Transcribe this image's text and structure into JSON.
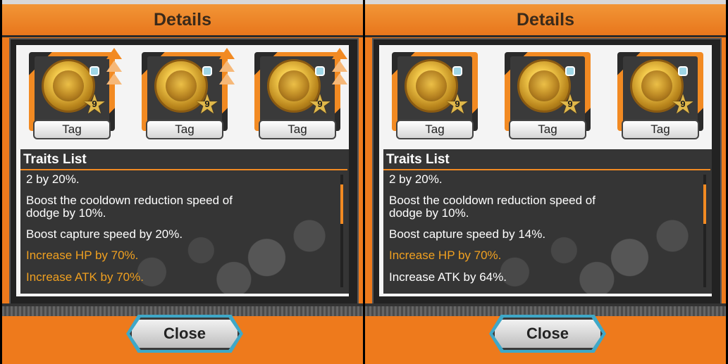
{
  "panels": [
    {
      "title": "Details",
      "cards": [
        {
          "tag": "Tag",
          "level": "9",
          "shield_icon": "shield-icon",
          "arrow_icon": "up-arrow-icon"
        },
        {
          "tag": "Tag",
          "level": "9",
          "shield_icon": "shield-icon",
          "arrow_icon": "up-arrow-icon"
        },
        {
          "tag": "Tag",
          "level": "9",
          "shield_icon": "shield-icon",
          "arrow_icon": "up-arrow-icon"
        }
      ],
      "traits_title": "Traits List",
      "traits": [
        {
          "text": "2 by 20%.",
          "highlight": false
        },
        {
          "text": "Boost the cooldown reduction speed of",
          "highlight": false
        },
        {
          "text": "dodge by 10%.",
          "highlight": false
        },
        {
          "text": "Boost capture speed by 20%.",
          "highlight": false
        },
        {
          "text": "Increase HP by 70%.",
          "highlight": true
        },
        {
          "text": "Increase ATK by 70%.",
          "highlight": true
        }
      ],
      "close_label": "Close"
    },
    {
      "title": "Details",
      "cards": [
        {
          "tag": "Tag",
          "level": "9",
          "shield_icon": "shield-icon"
        },
        {
          "tag": "Tag",
          "level": "9",
          "shield_icon": "shield-icon"
        },
        {
          "tag": "Tag",
          "level": "9",
          "shield_icon": "shield-icon"
        }
      ],
      "traits_title": "Traits List",
      "traits": [
        {
          "text": "2 by 20%.",
          "highlight": false
        },
        {
          "text": "Boost the cooldown reduction speed of",
          "highlight": false
        },
        {
          "text": "dodge by 10%.",
          "highlight": false
        },
        {
          "text": "Boost capture speed by 14%.",
          "highlight": false
        },
        {
          "text": "Increase HP by 70%.",
          "highlight": true
        },
        {
          "text": "Increase ATK by 64%.",
          "highlight": false
        }
      ],
      "close_label": "Close"
    }
  ],
  "colors": {
    "accent_orange": "#ee7a1c",
    "highlight_text": "#f0a020",
    "dark_panel": "#353535"
  }
}
